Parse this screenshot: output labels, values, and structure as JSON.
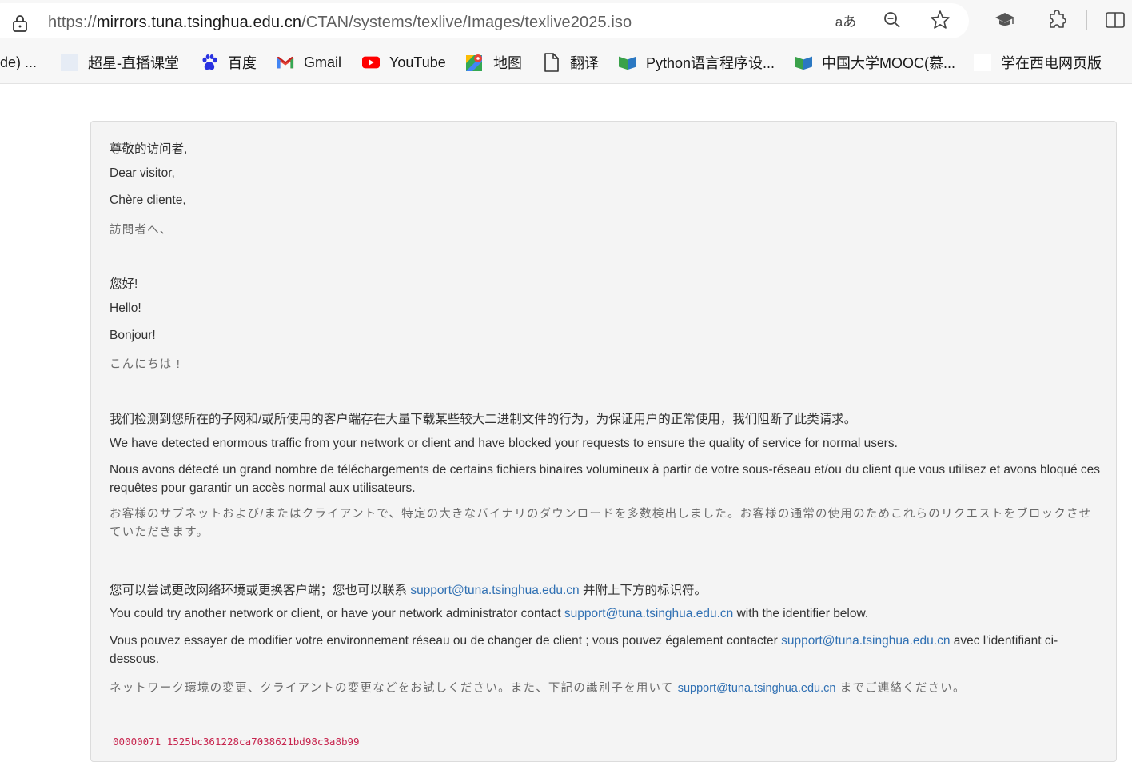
{
  "browser": {
    "url_scheme": "https://",
    "url_host": "mirrors.tuna.tsinghua.edu.cn",
    "url_path": "/CTAN/systems/texlive/Images/texlive2025.iso",
    "read_aloud_label": "aあ"
  },
  "bookmarks": [
    {
      "label": "de)  ...",
      "icon": "truncated"
    },
    {
      "label": "超星-直播课堂",
      "icon": "blank-page-icon"
    },
    {
      "label": "百度",
      "icon": "baidu-paw-icon"
    },
    {
      "label": "Gmail",
      "icon": "gmail-icon"
    },
    {
      "label": "YouTube",
      "icon": "youtube-icon"
    },
    {
      "label": "地图",
      "icon": "maps-icon"
    },
    {
      "label": "翻译",
      "icon": "document-icon"
    },
    {
      "label": "Python语言程序设...",
      "icon": "mooc-icon"
    },
    {
      "label": "中国大学MOOC(慕...",
      "icon": "mooc-icon"
    },
    {
      "label": "学在西电网页版",
      "icon": "blank-page-icon"
    }
  ],
  "message": {
    "greeting_zh": "尊敬的访问者,",
    "greeting_en": "Dear visitor,",
    "greeting_fr": "Chère cliente,",
    "greeting_jp": "訪問者へ、",
    "hello_zh": "您好!",
    "hello_en": "Hello!",
    "hello_fr": "Bonjour!",
    "hello_jp": "こんにちは !",
    "detect_zh": "我们检测到您所在的子网和/或所使用的客户端存在大量下载某些较大二进制文件的行为，为保证用户的正常使用，我们阻断了此类请求。",
    "detect_en": "We have detected enormous traffic from your network or client and have blocked your requests to ensure the quality of service for normal users.",
    "detect_fr": "Nous avons détecté un grand nombre de téléchargements de certains fichiers binaires volumineux à partir de votre sous-réseau et/ou du client que vous utilisez et avons bloqué ces requêtes pour garantir un accès normal aux utilisateurs.",
    "detect_jp": "お客様のサブネットおよび/またはクライアントで、特定の大きなバイナリのダウンロードを多数検出しました。お客様の通常の使用のためこれらのリクエストをブロックさせていただきます。",
    "contact_zh_before": "您可以尝试更改网络环境或更换客户端；您也可以联系 ",
    "contact_zh_after": " 并附上下方的标识符。",
    "contact_en_before": "You could try another network or client, or have your network administrator contact ",
    "contact_en_after": " with the identifier below.",
    "contact_fr_before": "Vous pouvez essayer de modifier votre environnement réseau ou de changer de client ; vous pouvez également contacter ",
    "contact_fr_after": " avec l'identifiant ci-dessous.",
    "contact_jp_before": "ネットワーク環境の変更、クライアントの変更などをお試しください。また、下記の識別子を用いて ",
    "contact_jp_after": " までご連絡ください。",
    "support_email": "support@tuna.tsinghua.edu.cn",
    "identifier": "00000071 1525bc361228ca7038621bd98c3a8b99"
  },
  "colors": {
    "link": "#3070b3",
    "identifier": "#c7254e",
    "card_bg": "#f4f4f4"
  }
}
